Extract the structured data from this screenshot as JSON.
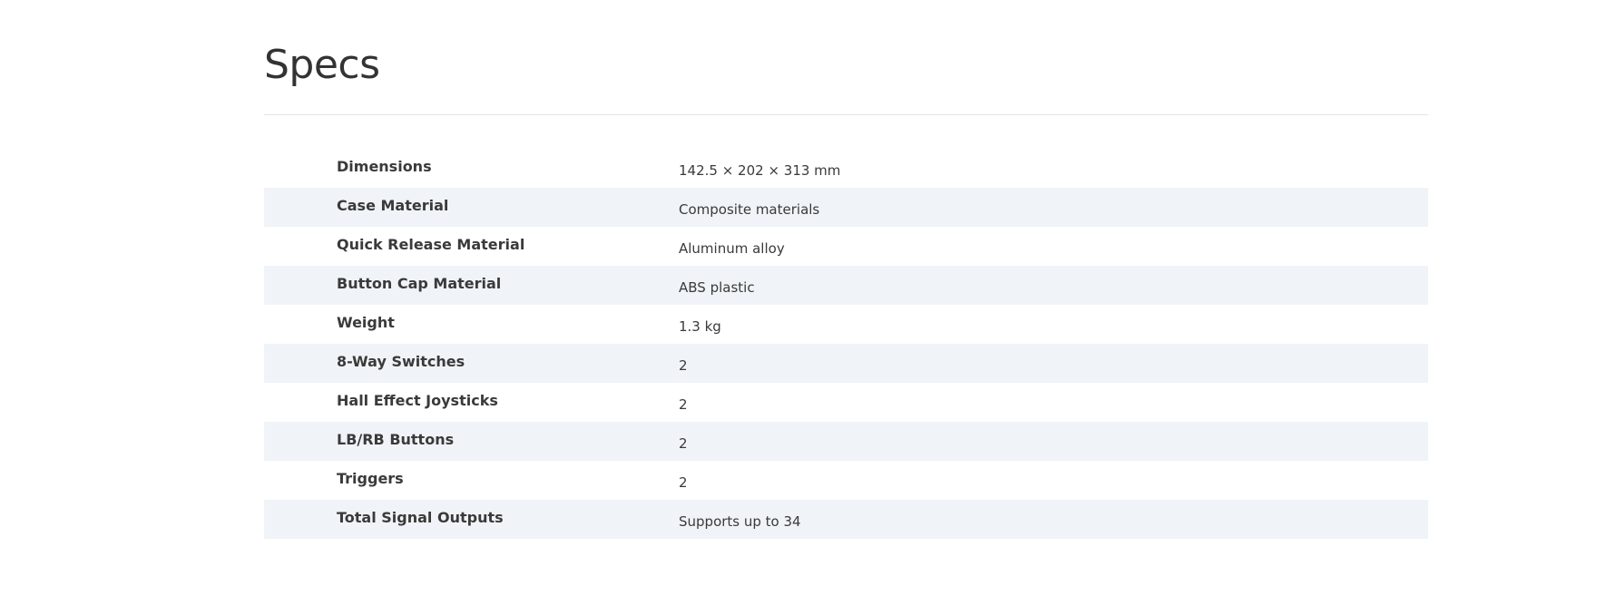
{
  "page": {
    "title": "Specs"
  },
  "specs": [
    {
      "label": "Dimensions",
      "value": "142.5 × 202 × 313 mm"
    },
    {
      "label": "Case Material",
      "value": "Composite materials"
    },
    {
      "label": "Quick Release Material",
      "value": "Aluminum alloy"
    },
    {
      "label": "Button Cap Material",
      "value": "ABS plastic"
    },
    {
      "label": "Weight",
      "value": "1.3 kg"
    },
    {
      "label": "8-Way Switches",
      "value": "2"
    },
    {
      "label": "Hall Effect Joysticks",
      "value": "2"
    },
    {
      "label": "LB/RB Buttons",
      "value": "2"
    },
    {
      "label": "Triggers",
      "value": "2"
    },
    {
      "label": "Total Signal Outputs",
      "value": "Supports up to 34"
    }
  ],
  "colors": {
    "background": "#ffffff",
    "row_alt": "#f0f4f8",
    "text": "#333333",
    "divider": "#e2e5e9"
  }
}
